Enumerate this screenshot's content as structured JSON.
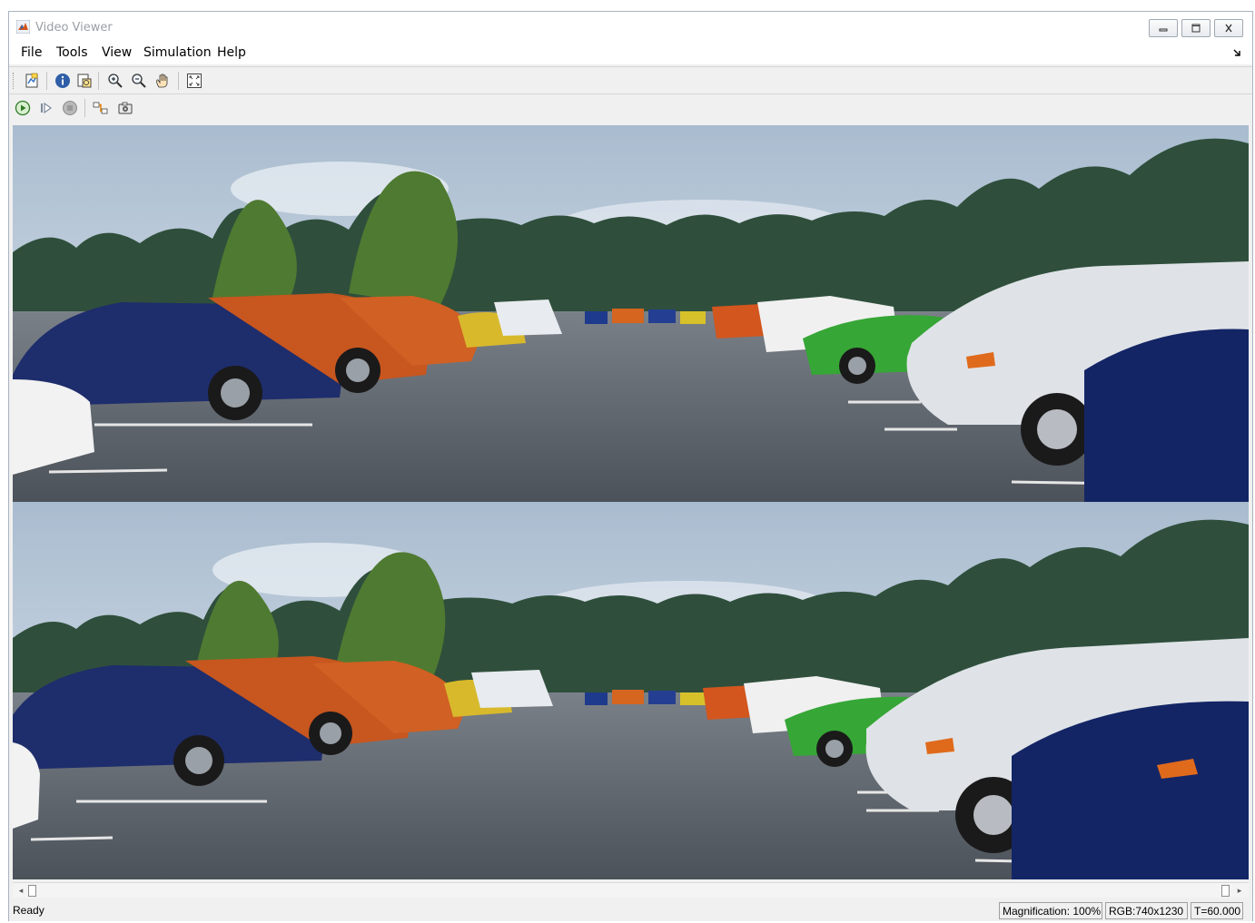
{
  "window": {
    "title": "Video Viewer",
    "controls": [
      "minimize-icon",
      "maximize-icon",
      "close-icon"
    ]
  },
  "menu": {
    "items": [
      "File",
      "Tools",
      "View",
      "Simulation",
      "Help"
    ]
  },
  "toolbar1": {
    "icons": [
      "print-to-figure-icon",
      "info-icon",
      "zoom-fit-icon",
      "zoom-in-icon",
      "zoom-out-icon",
      "pan-hand-icon",
      "maintain-fit-icon"
    ]
  },
  "toolbar2": {
    "icons": [
      "run-icon",
      "step-forward-icon",
      "stop-icon",
      "highlight-signal-icon",
      "snapshot-icon"
    ]
  },
  "video": {
    "frames": [
      {
        "name": "top-camera-frame",
        "scene": "parking-lot"
      },
      {
        "name": "bottom-camera-frame",
        "scene": "parking-lot"
      }
    ],
    "colors": {
      "sky": "#c9d6e3",
      "asphalt": "#5d636b",
      "trees": "#2f4f3c"
    }
  },
  "status": {
    "ready": "Ready",
    "magnification": "Magnification: 100%",
    "rgb": "RGB:740x1230",
    "time": "T=60.000"
  }
}
